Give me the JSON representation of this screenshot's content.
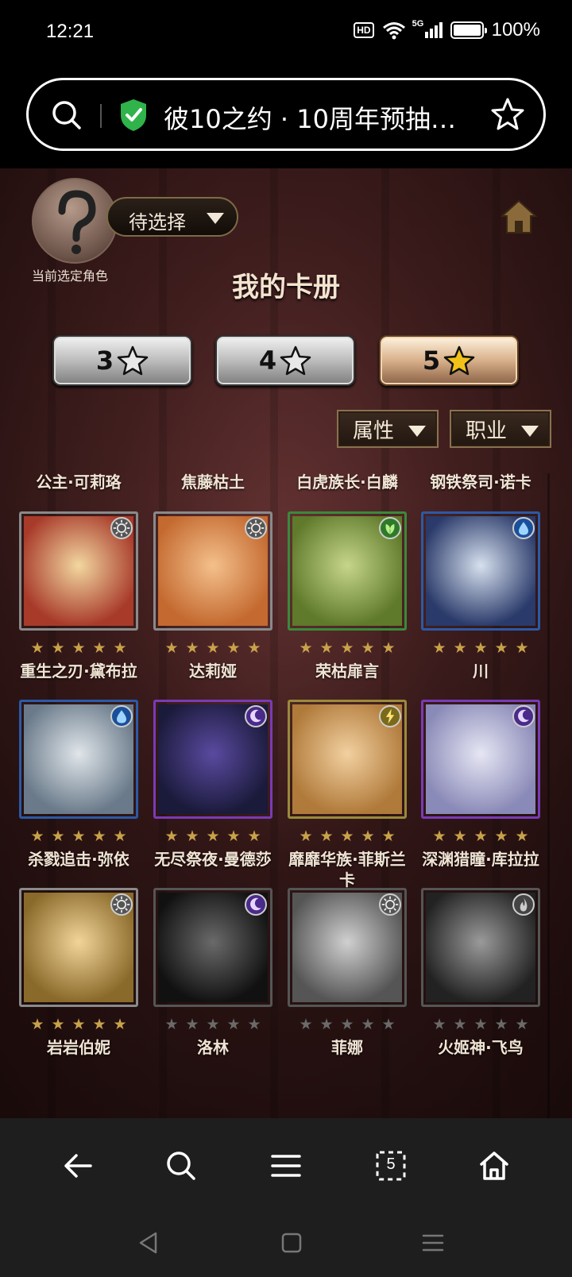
{
  "status_bar": {
    "time": "12:21",
    "hd": "HD",
    "network": "5G",
    "battery": "100%"
  },
  "browser": {
    "url_title": "彼10之约 · 10周年预抽卡..."
  },
  "game": {
    "select_label": "待选择",
    "current_role_label": "当前选定角色",
    "title": "我的卡册",
    "star_tabs": [
      {
        "label": "3",
        "active": false
      },
      {
        "label": "4",
        "active": false
      },
      {
        "label": "5",
        "active": true
      }
    ],
    "filters": {
      "attribute": "属性",
      "job": "职业"
    },
    "cards": [
      {
        "name": "公主·可莉珞",
        "stars": "★★★★★",
        "frame": "#3a5aa8",
        "element": "",
        "art": [
          "#5a4a3a",
          "#c9a679"
        ]
      },
      {
        "name": "焦藤枯土",
        "stars": "★★★★★",
        "frame": "#3a7a3a",
        "element": "",
        "art": [
          "#4a3a2a",
          "#b78d5f"
        ]
      },
      {
        "name": "白虎族长·白麟",
        "stars": "★★★★★",
        "frame": "#8a7a2a",
        "element": "",
        "art": [
          "#4a4a4a",
          "#a8a8a8"
        ]
      },
      {
        "name": "钢铁祭司·诺卡",
        "stars": "★★★★★",
        "frame": "#3a7a3a",
        "element": "",
        "art": [
          "#4a4a3a",
          "#a89a7a"
        ]
      },
      {
        "name": "重生之刃·黛布拉",
        "stars": "★★★★★",
        "frame": "#8a8a8a",
        "element": "light",
        "art": [
          "#a83a2a",
          "#f2d7a0"
        ]
      },
      {
        "name": "达莉娅",
        "stars": "★★★★★",
        "frame": "#8a8a8a",
        "element": "light",
        "art": [
          "#c46a30",
          "#f4c08c"
        ]
      },
      {
        "name": "荣枯扉言",
        "stars": "★★★★★",
        "frame": "#3a8a3a",
        "element": "wood",
        "art": [
          "#5f7a2a",
          "#c6d68a"
        ]
      },
      {
        "name": "川",
        "stars": "★★★★★",
        "frame": "#2a5aa8",
        "element": "water",
        "art": [
          "#2a3a6a",
          "#d6e0ee"
        ]
      },
      {
        "name": "杀戮追击·弥依",
        "stars": "★★★★★",
        "frame": "#2a5aa8",
        "element": "water",
        "art": [
          "#6a7a8a",
          "#e0e6ea"
        ]
      },
      {
        "name": "无尽祭夜·曼德莎",
        "stars": "★★★★★",
        "frame": "#7a3ab8",
        "element": "dark",
        "art": [
          "#1a1a3a",
          "#5a4aa0"
        ]
      },
      {
        "name": "靡靡华族·菲斯兰卡",
        "stars": "★★★★★",
        "frame": "#9a8a3a",
        "element": "thunder",
        "art": [
          "#b07a3a",
          "#f2d0a0"
        ]
      },
      {
        "name": "深渊猎瞳·库拉拉",
        "stars": "★★★★★",
        "frame": "#7a3ab8",
        "element": "dark",
        "art": [
          "#8a8ab8",
          "#e6e6f4"
        ]
      },
      {
        "name": "岩岩伯妮",
        "stars": "★★★★★",
        "frame": "#8a8a8a",
        "element": "light",
        "art": [
          "#8a6a2a",
          "#f2d49a"
        ]
      },
      {
        "name": "洛林",
        "stars": "★★★★★",
        "frame": "#555555",
        "element": "dark",
        "art": [
          "#111111",
          "#6a6a6a"
        ],
        "locked": true
      },
      {
        "name": "菲娜",
        "stars": "★★★★★",
        "frame": "#555555",
        "element": "light",
        "art": [
          "#555555",
          "#d0d0d0"
        ],
        "locked": true
      },
      {
        "name": "火姬神·飞鸟",
        "stars": "★★★★★",
        "frame": "#555555",
        "element": "fire",
        "art": [
          "#222222",
          "#9a9a9a"
        ],
        "locked": true
      }
    ]
  },
  "bottom_bar": {
    "tab_count": "5"
  },
  "colors": {
    "star_gold": "#c8a24a",
    "star_dim": "#6a6a6a",
    "title": "#f3e3cf",
    "star_fill": "#f2c218"
  }
}
